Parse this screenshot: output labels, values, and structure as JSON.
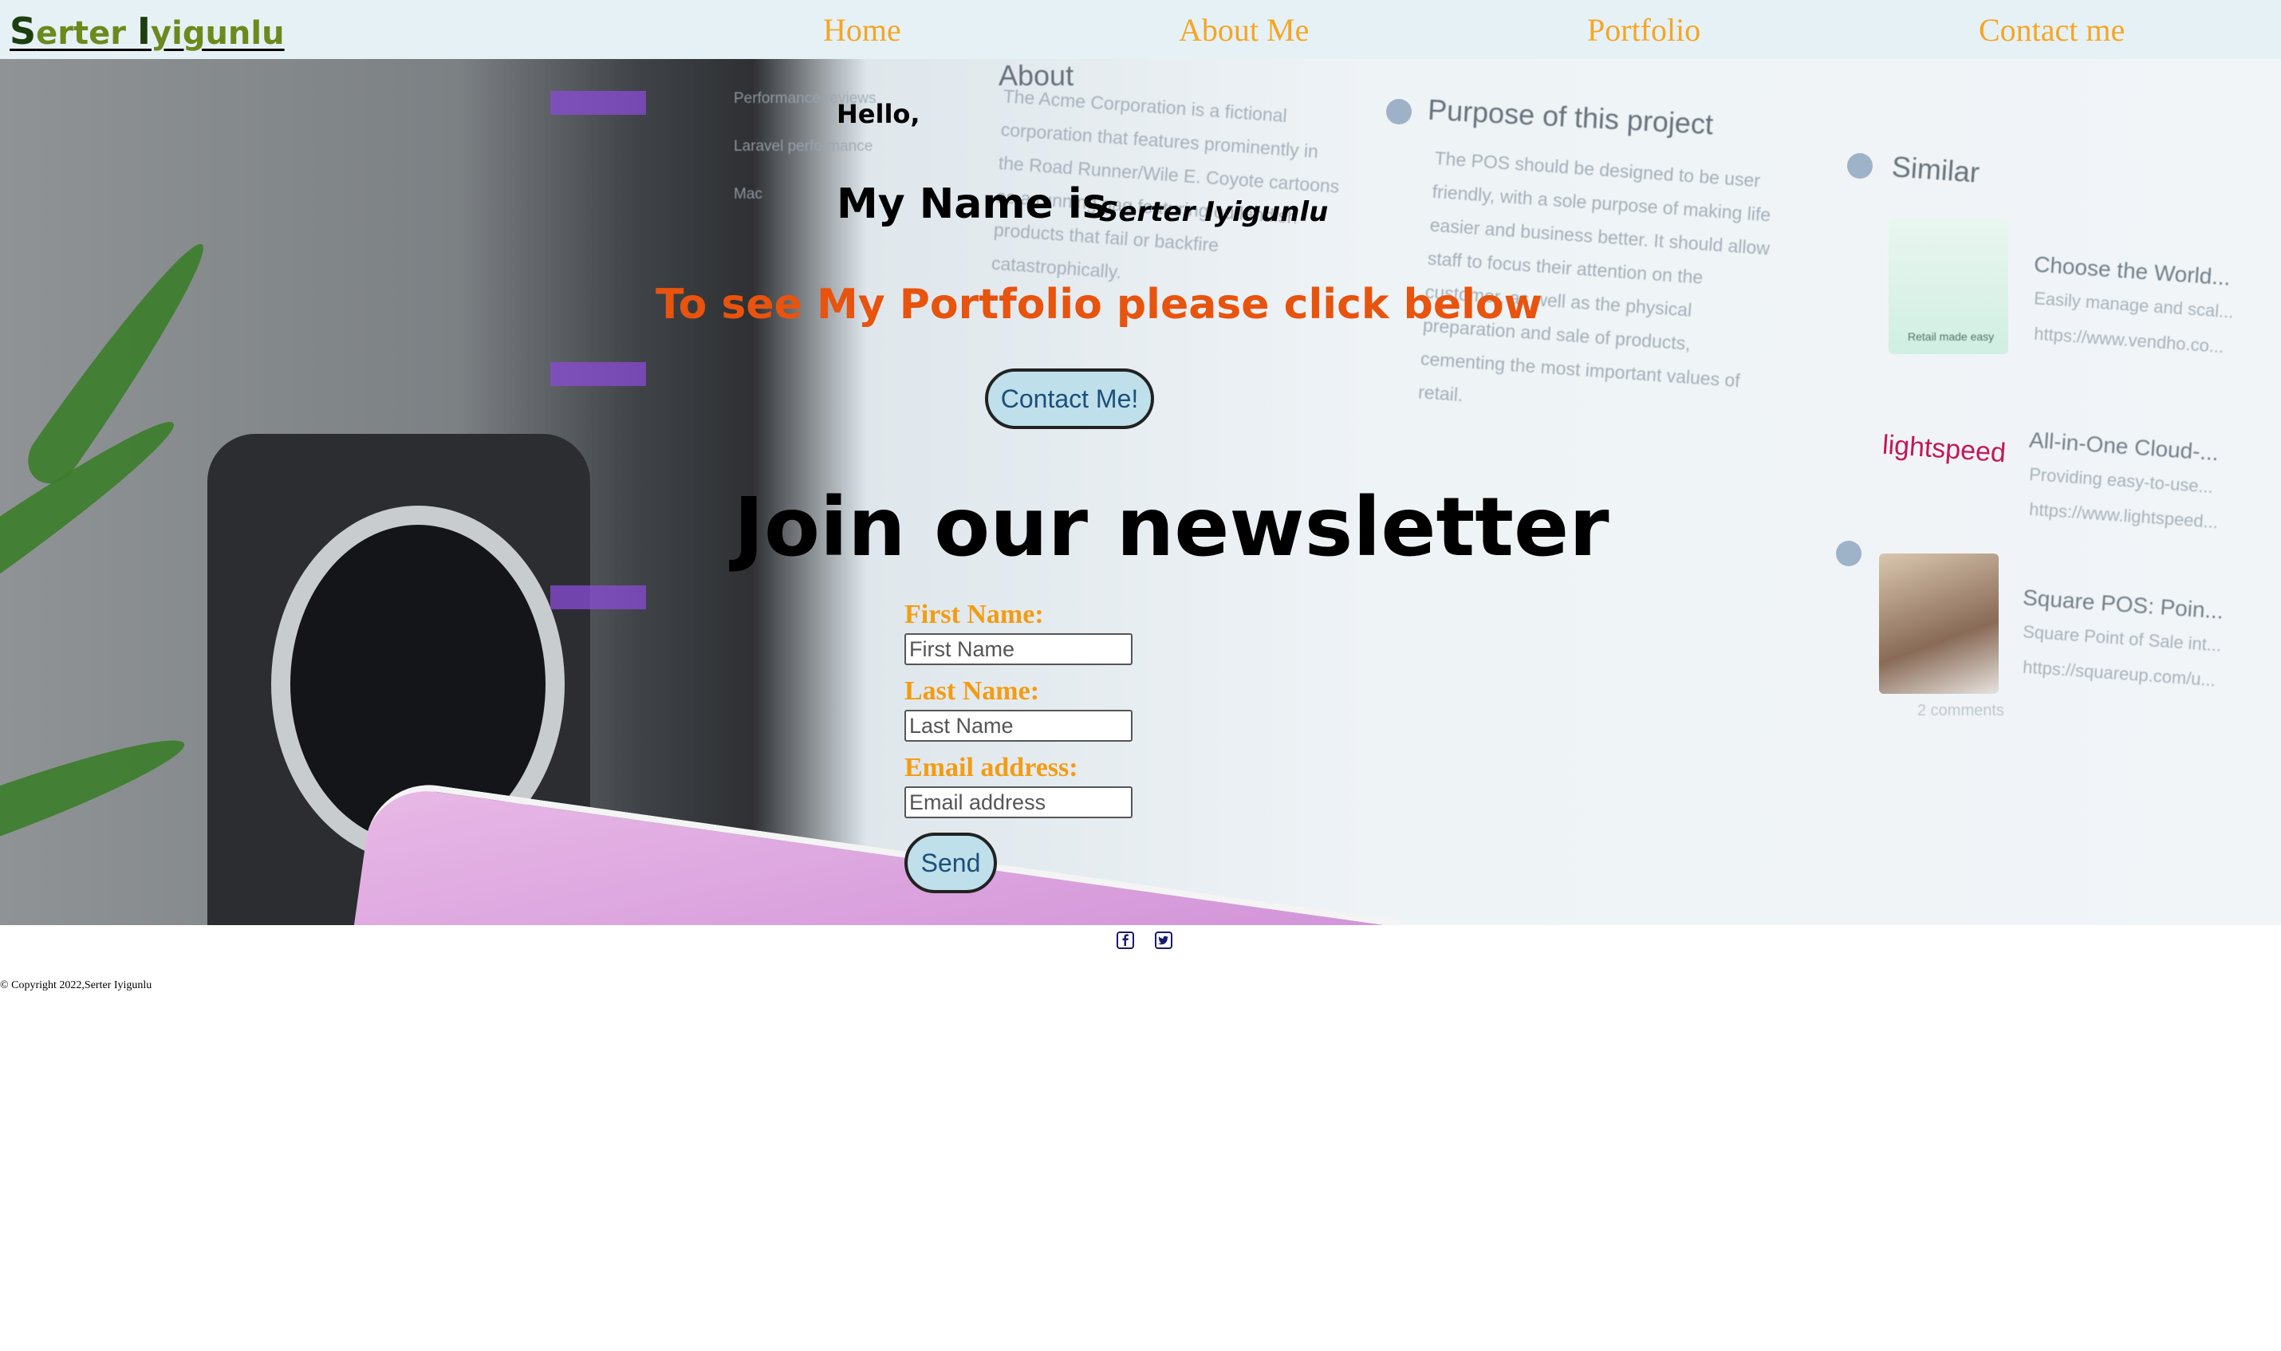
{
  "header": {
    "logo": {
      "first_initial": "S",
      "first_rest": "erter ",
      "last_initial": "I",
      "last_rest": "yigunlu"
    },
    "nav": [
      {
        "label": "Home"
      },
      {
        "label": "About Me"
      },
      {
        "label": "Portfolio"
      },
      {
        "label": "Contact me"
      }
    ]
  },
  "hero": {
    "greeting": "Hello,",
    "name_prefix": "My Name is",
    "name": "Serter Iyigunlu",
    "cta_text": "To see My Portfolio please click below",
    "contact_button": "Contact Me!"
  },
  "background_screen": {
    "about_title": "About",
    "about_text": "The Acme Corporation is a fictional corporation that features prominently in the Road Runner/Wile E. Coyote cartoons as a running gag featuring outlandish products that fail or backfire catastrophically.",
    "purpose_title": "Purpose of this project",
    "purpose_text": "The POS should be designed to be user friendly, with a sole purpose of making life easier and business better. It should allow staff to focus their attention on the customer, as well as the physical preparation and sale of products, cementing the most important values of retail.",
    "similar_title": "Similar",
    "similar_items": [
      {
        "title": "Choose the World...",
        "desc": "Easily manage and scal...",
        "url": "https://www.vendho.co..."
      },
      {
        "title": "All-in-One Cloud-...",
        "desc": "Providing easy-to-use...",
        "url": "https://www.lightspeed..."
      },
      {
        "title": "Square POS: Poin...",
        "desc": "Square Point of Sale int...",
        "url": "https://squareup.com/u..."
      }
    ],
    "comments": "2 comments",
    "lightspeed_logo": "lightspeed",
    "thumb_caption": "Retail made easy",
    "sidebar": [
      "Performance reviews",
      "Laravel performance",
      "Mac"
    ]
  },
  "newsletter": {
    "title": "Join our newsletter",
    "first_name_label": "First Name:",
    "first_name_placeholder": "First Name",
    "last_name_label": "Last Name:",
    "last_name_placeholder": "Last Name",
    "email_label": "Email address:",
    "email_placeholder": "Email address",
    "send_button": "Send"
  },
  "footer": {
    "social_icons": [
      "facebook-icon",
      "twitter-icon"
    ],
    "copyright": "© Copyright 2022,Serter Iyigunlu"
  },
  "colors": {
    "nav_link": "#f5a623",
    "cta": "#e8530e",
    "form_label": "#f39c12",
    "button_bg": "#bfe0ea",
    "navbar_bg": "#e6f1f6"
  }
}
